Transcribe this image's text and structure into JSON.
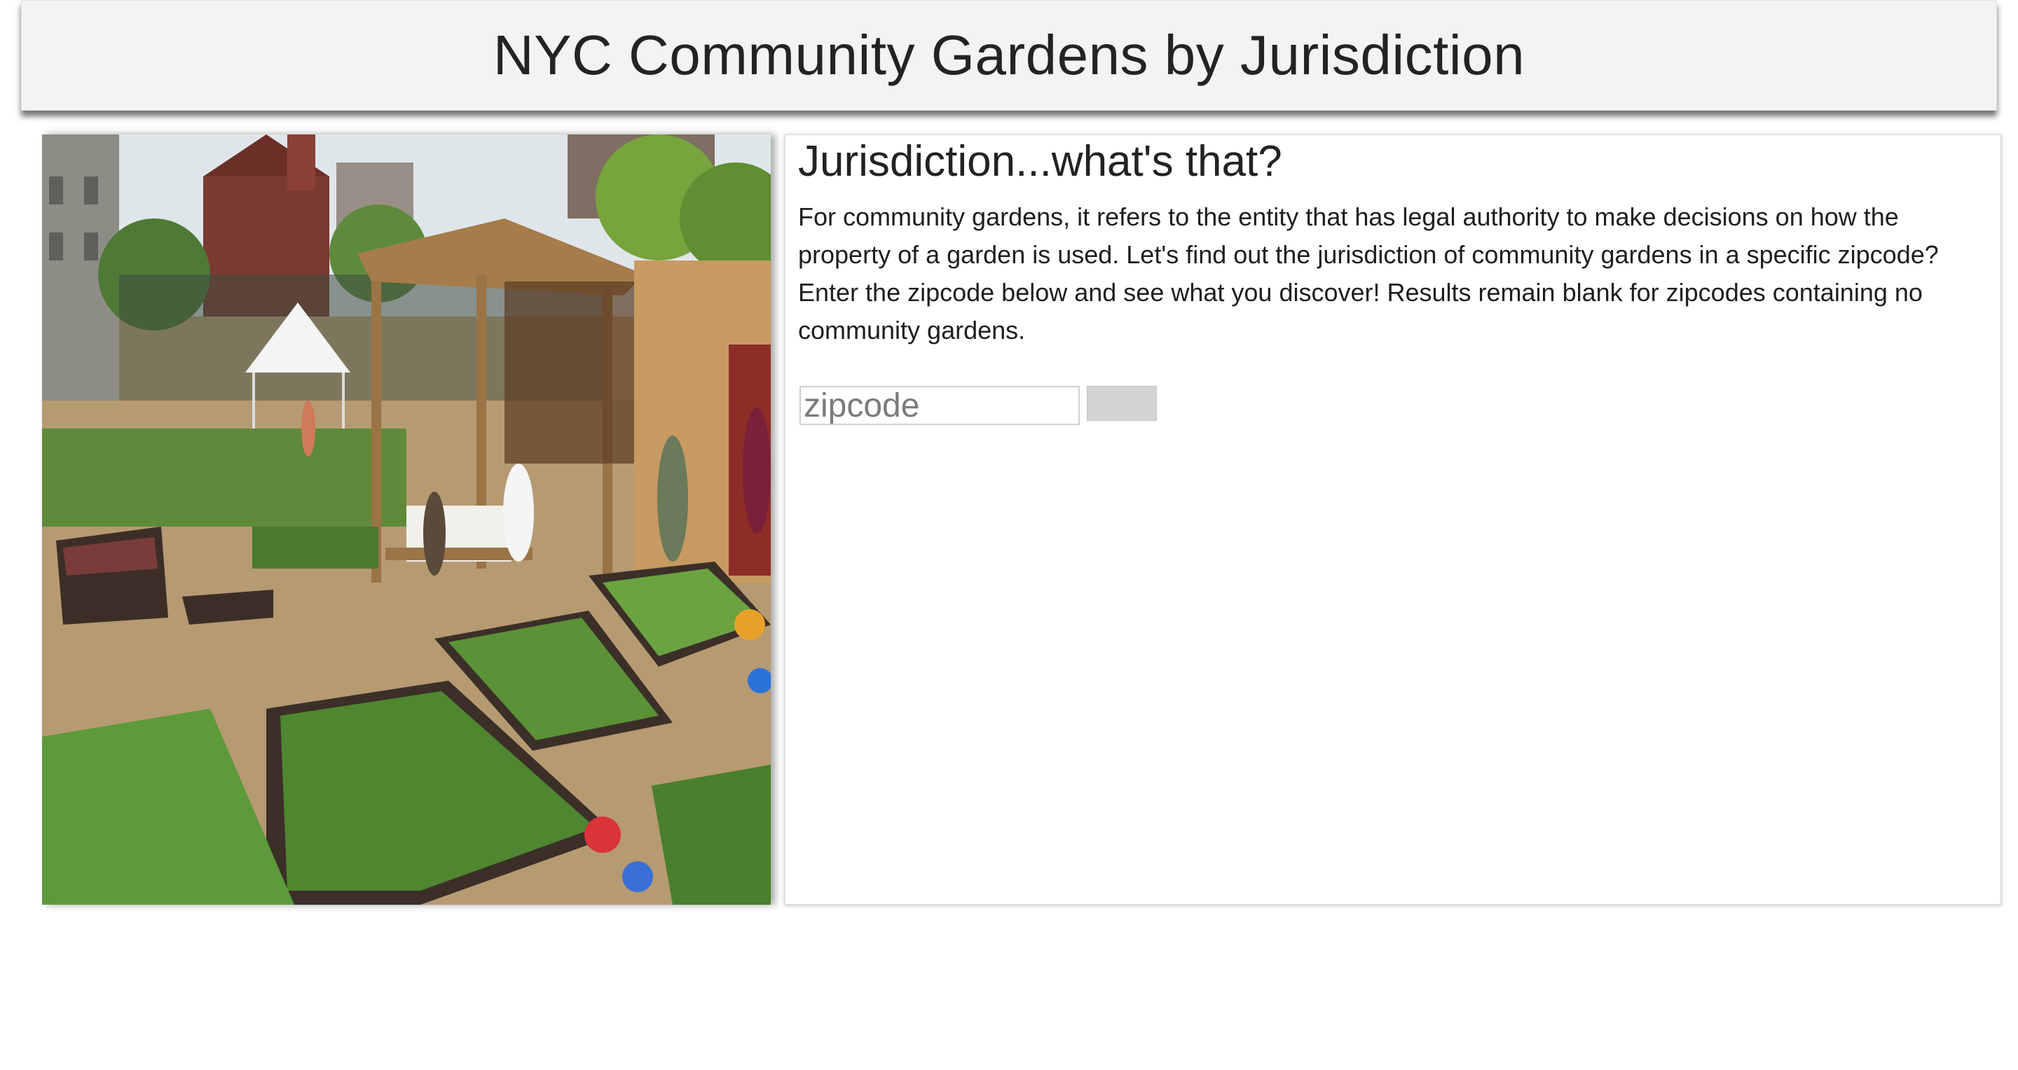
{
  "header": {
    "title": "NYC Community Gardens by Jurisdiction"
  },
  "photo": {
    "subject": "community-garden-raised-beds"
  },
  "info": {
    "heading": "Jurisdiction...what's that?",
    "body": "For community gardens, it refers to the entity that has legal authority to make decisions on how the property of a garden is used. Let's find out the jurisdiction of community gardens in a specific zipcode? Enter the zipcode below and see what you discover! Results remain blank for zipcodes containing no community gardens."
  },
  "search": {
    "value": "",
    "placeholder": "zipcode",
    "submit_label": ""
  },
  "colors": {
    "header_bg": "#f3f3f3",
    "button_bg": "#d3d3d3",
    "text": "#222222"
  }
}
